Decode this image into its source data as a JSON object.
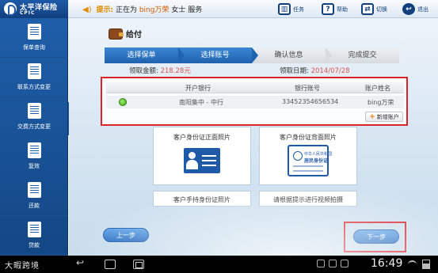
{
  "app": {
    "logo_cn": "太平洋保险",
    "logo_en": "CPIC"
  },
  "header": {
    "tip_label": "提示:",
    "tip_prefix": "正在为",
    "tip_name": "bing万荣",
    "tip_suffix": "女士 服务",
    "buttons": [
      {
        "label": "任务",
        "icon": "book-icon"
      },
      {
        "label": "帮助",
        "icon": "help-icon"
      },
      {
        "label": "切换",
        "icon": "switch-icon"
      },
      {
        "label": "退出",
        "icon": "exit-icon"
      }
    ]
  },
  "sidebar": {
    "items": [
      {
        "label": "保单查询",
        "icon": "document-search-icon"
      },
      {
        "label": "联系方式变更",
        "icon": "contact-icon"
      },
      {
        "label": "交费方式变更",
        "icon": "payment-icon"
      },
      {
        "label": "复效",
        "icon": "reinstate-icon"
      },
      {
        "label": "还款",
        "icon": "repay-icon"
      },
      {
        "label": "贷款",
        "icon": "loan-icon"
      }
    ],
    "collapse_glyph": "›"
  },
  "page": {
    "title": "给付",
    "steps": [
      {
        "label": "选择保单",
        "state": "done"
      },
      {
        "label": "选择账号",
        "state": "active"
      },
      {
        "label": "确认信息",
        "state": "todo"
      },
      {
        "label": "完成提交",
        "state": "todo"
      }
    ],
    "amount_label": "领取金额:",
    "amount_value": "218.28元",
    "date_label": "领取日期:",
    "date_value": "2014/07/28"
  },
  "bank_table": {
    "headers": [
      "开户银行",
      "银行账号",
      "账户姓名"
    ],
    "rows": [
      {
        "bank": "南阳集中 - 中行",
        "account": "33452354656534",
        "name": "bing万荣",
        "selected": true
      }
    ],
    "add_button": "新增账户"
  },
  "photos": {
    "front": "客户身份证正面照片",
    "back": "客户身份证背面照片",
    "hold": "客户手持身份证照片",
    "bank_card": "请根据提示进行视频拍摄",
    "back_card_line1": "中华人民共和国",
    "back_card_line2": "居民身份证"
  },
  "nav": {
    "prev": "上一步",
    "next": "下一步"
  },
  "statusbar": {
    "brand": "大暇跨境",
    "time": "16:49"
  },
  "colors": {
    "primary": "#1e5aa8",
    "highlight": "#d9222a",
    "amount": "#d9534f",
    "tip": "#e08a00"
  }
}
